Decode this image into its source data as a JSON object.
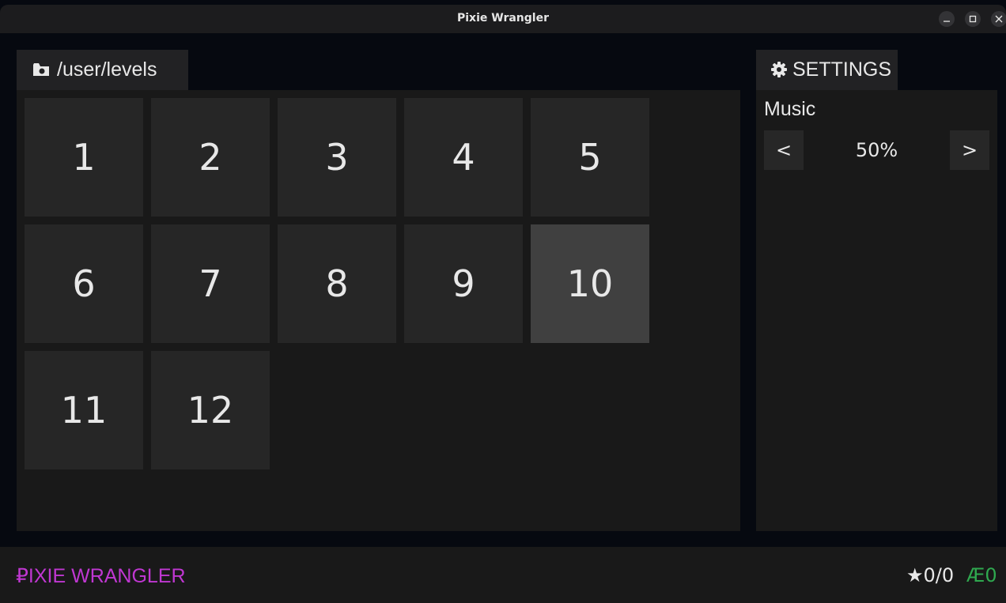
{
  "window": {
    "title": "Pixie Wrangler",
    "minimize_icon": "minimize-icon",
    "maximize_icon": "maximize-icon",
    "close_icon": "close-icon"
  },
  "levels": {
    "path_icon": "folder-icon",
    "path": "/user/levels",
    "tiles": [
      "1",
      "2",
      "3",
      "4",
      "5",
      "6",
      "7",
      "8",
      "9",
      "10",
      "11",
      "12"
    ],
    "selected": "10"
  },
  "settings": {
    "tab_icon": "gear-icon",
    "tab_label": "SETTINGS",
    "music_label": "Music",
    "decrease_label": "<",
    "music_value": "50%",
    "increase_label": ">"
  },
  "footer": {
    "brand": "₽IXIE WRANGLER",
    "stars": "★0/0",
    "coins": "Æ0"
  },
  "colors": {
    "brand": "#c037d2",
    "coins": "#2fa84f",
    "tile": "#262626",
    "tile_selected": "#404040"
  }
}
